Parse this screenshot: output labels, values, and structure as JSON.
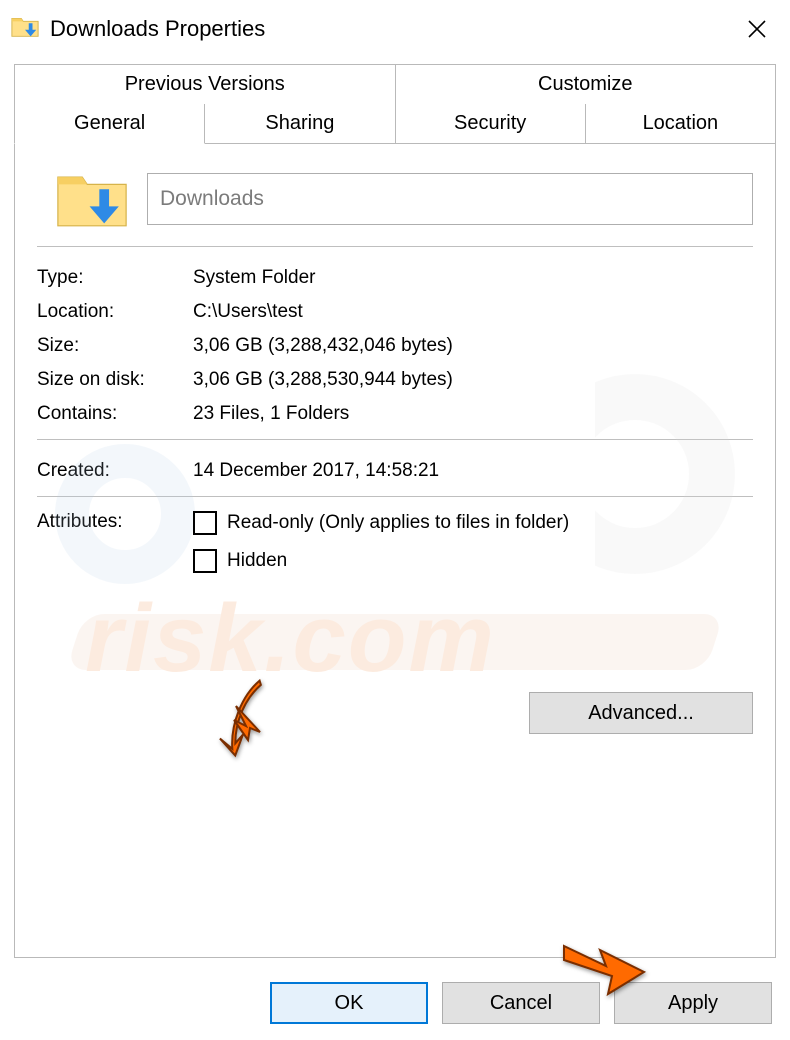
{
  "window": {
    "title": "Downloads Properties"
  },
  "tabs": {
    "top": [
      "Previous Versions",
      "Customize"
    ],
    "bottom": [
      "General",
      "Sharing",
      "Security",
      "Location"
    ],
    "active": "General"
  },
  "general": {
    "name_value": "Downloads",
    "rows": {
      "type_label": "Type:",
      "type_value": "System Folder",
      "location_label": "Location:",
      "location_value": "C:\\Users\\test",
      "size_label": "Size:",
      "size_value": "3,06 GB (3,288,432,046 bytes)",
      "sizeondisk_label": "Size on disk:",
      "sizeondisk_value": "3,06 GB (3,288,530,944 bytes)",
      "contains_label": "Contains:",
      "contains_value": "23 Files, 1 Folders",
      "created_label": "Created:",
      "created_value": "14 December 2017, 14:58:21",
      "attributes_label": "Attributes:",
      "readonly_label": "Read-only (Only applies to files in folder)",
      "hidden_label": "Hidden",
      "advanced_label": "Advanced..."
    }
  },
  "buttons": {
    "ok": "OK",
    "cancel": "Cancel",
    "apply": "Apply"
  }
}
